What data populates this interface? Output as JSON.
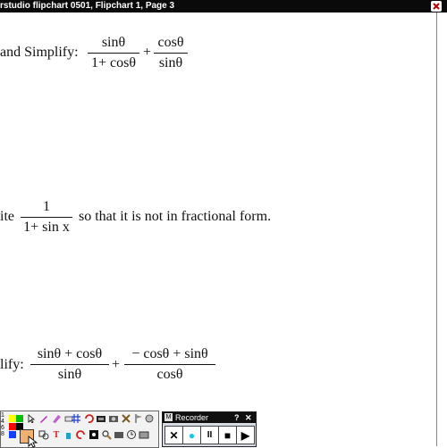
{
  "window": {
    "title": "rstudio  flipchart 0501,  Flipchart 1,  Page 3"
  },
  "problem1": {
    "text": "and Simplify:",
    "frac1_num": "sinθ",
    "frac1_den": "1+ cosθ",
    "plus": "+",
    "frac2_num": "cosθ",
    "frac2_den": "sinθ"
  },
  "problem2": {
    "prefix": "ite",
    "frac_num": "1",
    "frac_den": "1+ sin x",
    "suffix": "so that it is not in fractional form."
  },
  "problem3": {
    "text": "lify:",
    "frac1_num": "sinθ + cosθ",
    "frac1_den": "sinθ",
    "plus": "+",
    "frac2_num": "− cosθ + sinθ",
    "frac2_den": "cosθ"
  },
  "toolbox": {
    "row_numbers": [
      "1",
      "4",
      "6",
      "8"
    ],
    "swatch_colors": [
      "#ffff00",
      "#00c000",
      "#ff0000",
      "#000000",
      "#1040ff"
    ]
  },
  "recorder": {
    "title": "Recorder",
    "badge": "M",
    "help": "?",
    "close": "✕",
    "buttons": [
      "✕",
      "●",
      "II",
      "■",
      "▶"
    ]
  }
}
